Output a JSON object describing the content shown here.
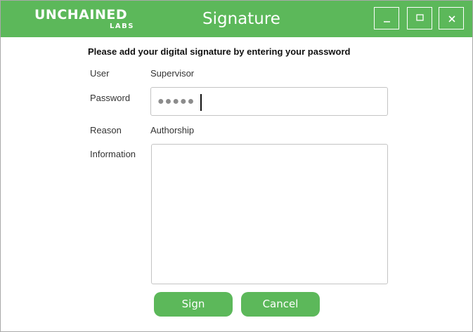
{
  "window": {
    "title": "Signature",
    "logo": {
      "main_text": "UNCHAINED",
      "sub_text": "LABS"
    },
    "controls": {
      "minimize_icon": "minimize-icon",
      "maximize_icon": "maximize-icon",
      "close_icon": "close-icon"
    }
  },
  "form": {
    "instruction": "Please add your digital signature by entering your password",
    "user": {
      "label": "User",
      "value": "Supervisor"
    },
    "password": {
      "label": "Password",
      "masked_value": "●●●●●"
    },
    "reason": {
      "label": "Reason",
      "value": "Authorship"
    },
    "information": {
      "label": "Information",
      "value": ""
    }
  },
  "buttons": {
    "sign": "Sign",
    "cancel": "Cancel"
  },
  "colors": {
    "accent": "#5cb85a",
    "border": "#c4c4c4"
  }
}
